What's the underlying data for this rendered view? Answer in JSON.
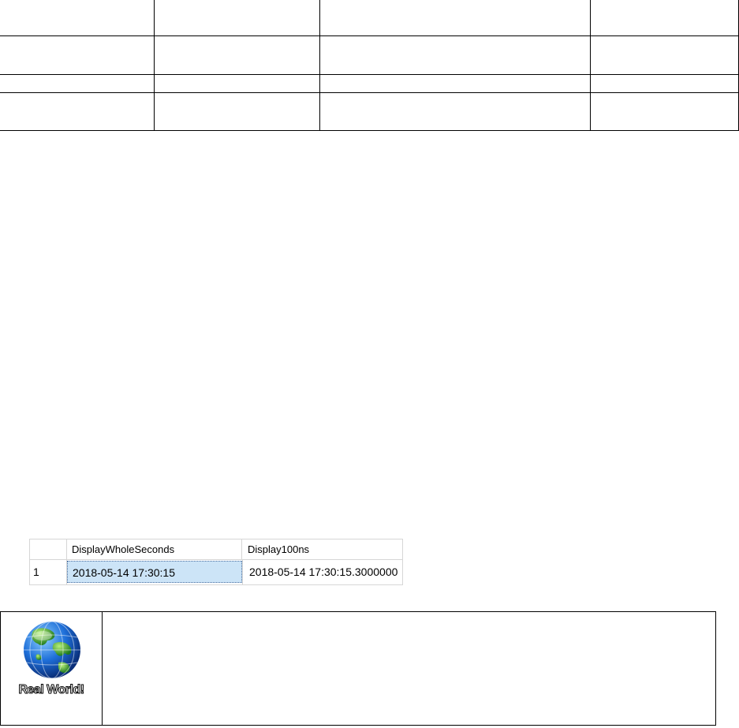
{
  "results_grid": {
    "columns": [
      "",
      "DisplayWholeSeconds",
      "Display100ns"
    ],
    "rows": [
      {
        "row_number": "1",
        "DisplayWholeSeconds": "2018-05-14 17:30:15",
        "Display100ns": "2018-05-14 17:30:15.3000000"
      }
    ]
  },
  "real_world_box": {
    "logo_text": "Real World!",
    "icon": "globe-icon"
  },
  "colors": {
    "selection": "#cce4f7",
    "grid_border": "#d6d6d6",
    "globe_ocean": "#1e6fd9",
    "globe_land": "#3cb043"
  }
}
